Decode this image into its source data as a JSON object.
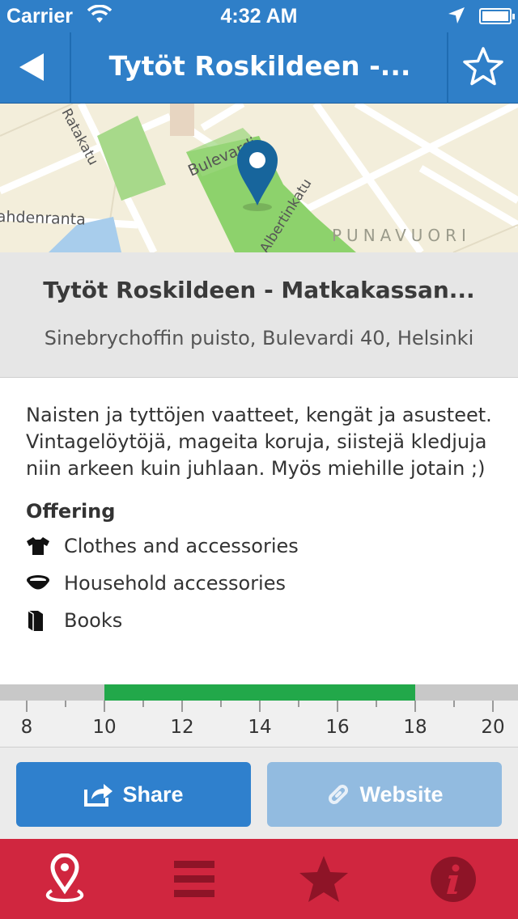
{
  "status_bar": {
    "carrier": "Carrier",
    "time": "4:32 AM",
    "icons": [
      "wifi-icon",
      "location-arrow-icon",
      "battery-icon"
    ]
  },
  "navbar": {
    "title": "Tytöt Roskildeen -...",
    "back_icon": "back-arrow-icon",
    "favorite_icon": "star-outline-icon"
  },
  "map": {
    "street_labels": [
      "Bulevardi",
      "Hietalahdenranta",
      "Albertinkatu",
      "Ratakatu"
    ],
    "district_label": "PUNAVUORI",
    "marker_icon": "map-pin-icon"
  },
  "place": {
    "name": "Tytöt Roskildeen - Matkakassan...",
    "address": "Sinebrychoffin puisto, Bulevardi 40, Helsinki"
  },
  "content": {
    "description": "Naisten ja tyttöjen vaatteet, kengät ja asusteet. Vintagelöytöjä, mageita koruja, siistejä kledjuja niin arkeen kuin juhlaan. Myös miehille jotain ;)",
    "offering_title": "Offering",
    "offerings": [
      {
        "label": "Clothes and accessories",
        "icon": "tshirt-icon"
      },
      {
        "label": "Household accessories",
        "icon": "bowl-icon"
      },
      {
        "label": "Books",
        "icon": "book-icon"
      }
    ]
  },
  "hours": {
    "labels": [
      "8",
      "10",
      "12",
      "14",
      "16",
      "18",
      "20"
    ],
    "range_start": 8,
    "range_end": 20,
    "open_from": 10,
    "open_to": 18,
    "open_color": "#22a84a"
  },
  "actions": {
    "share_label": "Share",
    "share_icon": "share-icon",
    "website_label": "Website",
    "website_icon": "link-icon"
  },
  "tabbar": {
    "tabs": [
      {
        "icon": "map-pin-tab-icon",
        "active": true
      },
      {
        "icon": "list-icon",
        "active": false
      },
      {
        "icon": "star-icon",
        "active": false
      },
      {
        "icon": "info-icon",
        "active": false
      }
    ],
    "background_color": "#d0263f"
  }
}
